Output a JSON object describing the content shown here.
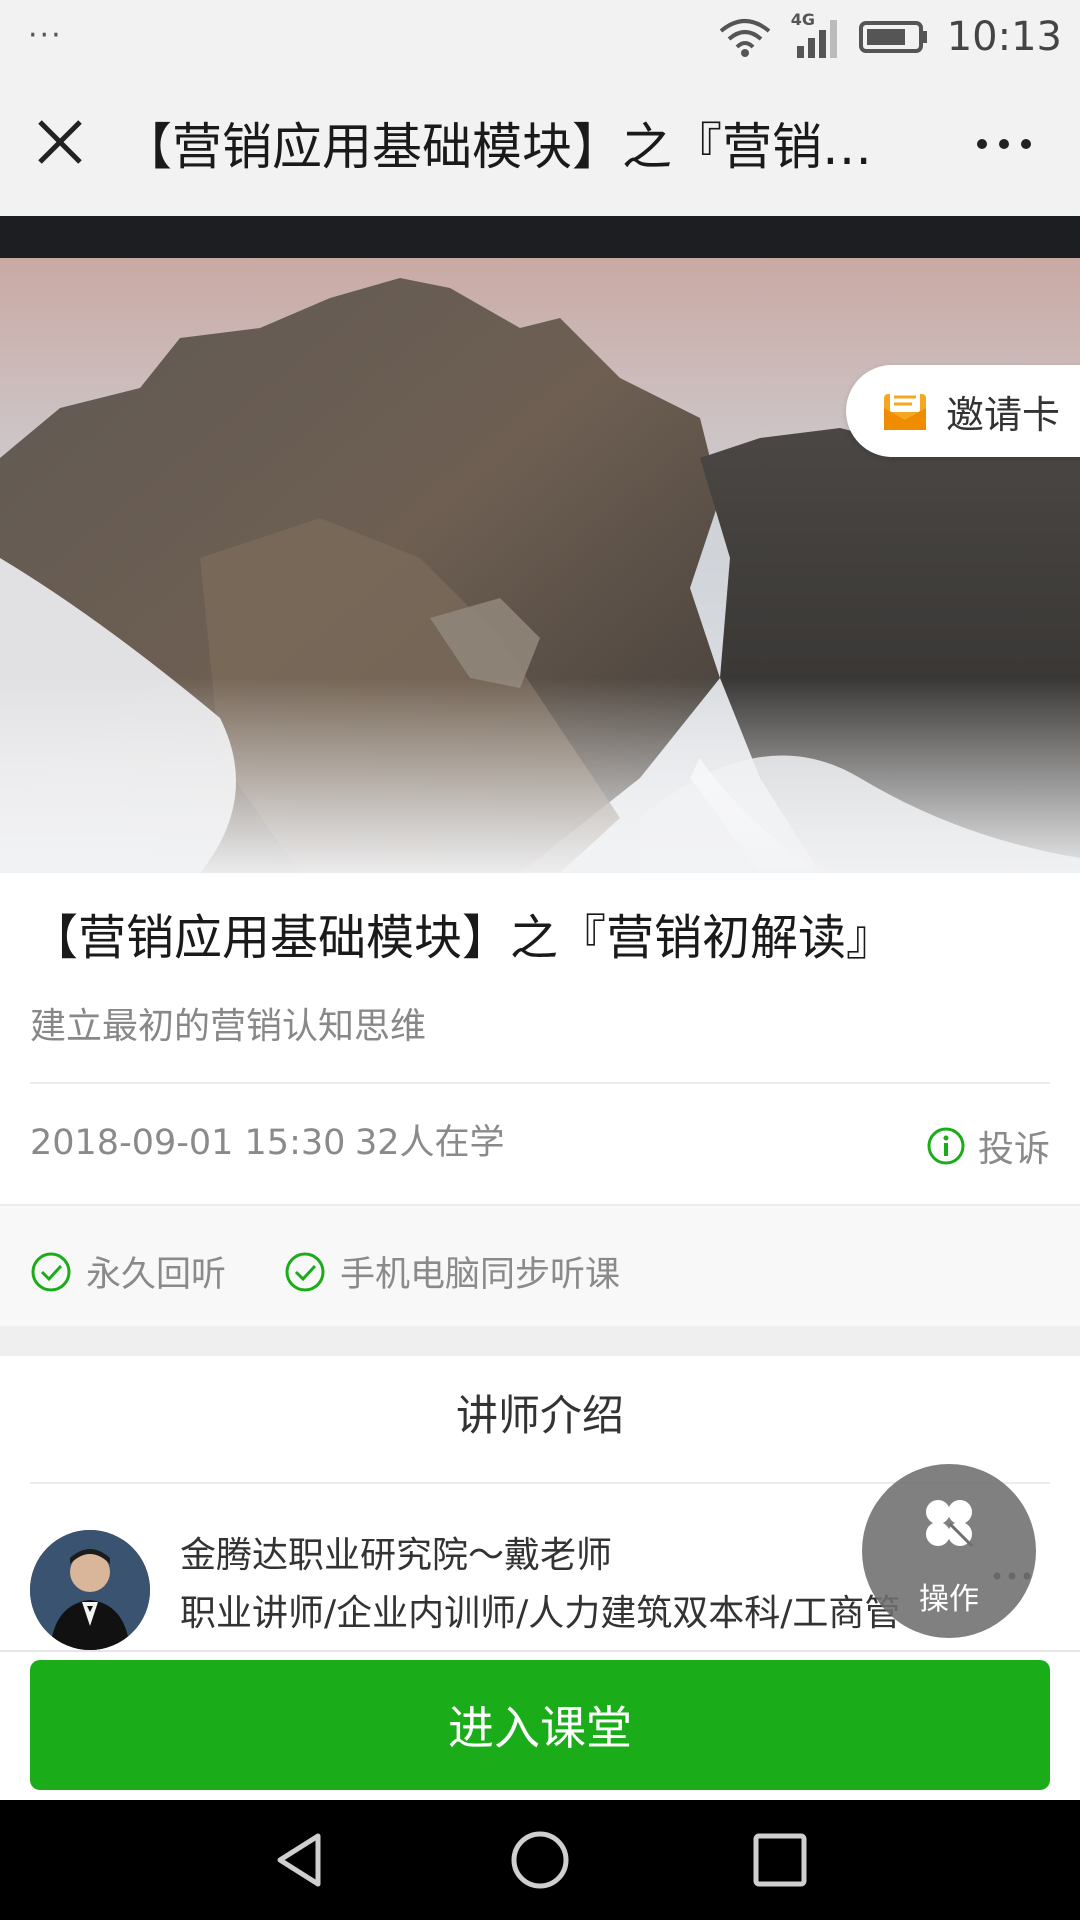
{
  "status_bar": {
    "dots": "···",
    "network": "4G",
    "time": "10:13"
  },
  "nav": {
    "title": "【营销应用基础模块】之『营销…",
    "close_icon": "close-icon",
    "more_icon": "more-icon"
  },
  "hero": {
    "image": "rocky-coast-mist-photo",
    "invite_label": "邀请卡",
    "invite_icon": "envelope-icon"
  },
  "course": {
    "title": "【营销应用基础模块】之『营销初解读』",
    "subtitle": "建立最初的营销认知思维",
    "date": "2018-09-01 15:30",
    "learners": "32人在学",
    "report_label": "投诉"
  },
  "features": [
    {
      "label": "永久回听"
    },
    {
      "label": "手机电脑同步听课"
    }
  ],
  "teacher_section": {
    "title": "讲师介绍",
    "name": "金腾达职业研究院～戴老师",
    "description": "职业讲师/企业内训师/人力建筑双本科/工商管"
  },
  "fab": {
    "label": "操作",
    "icon": "clover-icon"
  },
  "enter_button": "进入课堂",
  "colors": {
    "accent_green": "#1aad19",
    "icon_green": "#1aad19",
    "invite_orange": "#f5a623"
  }
}
